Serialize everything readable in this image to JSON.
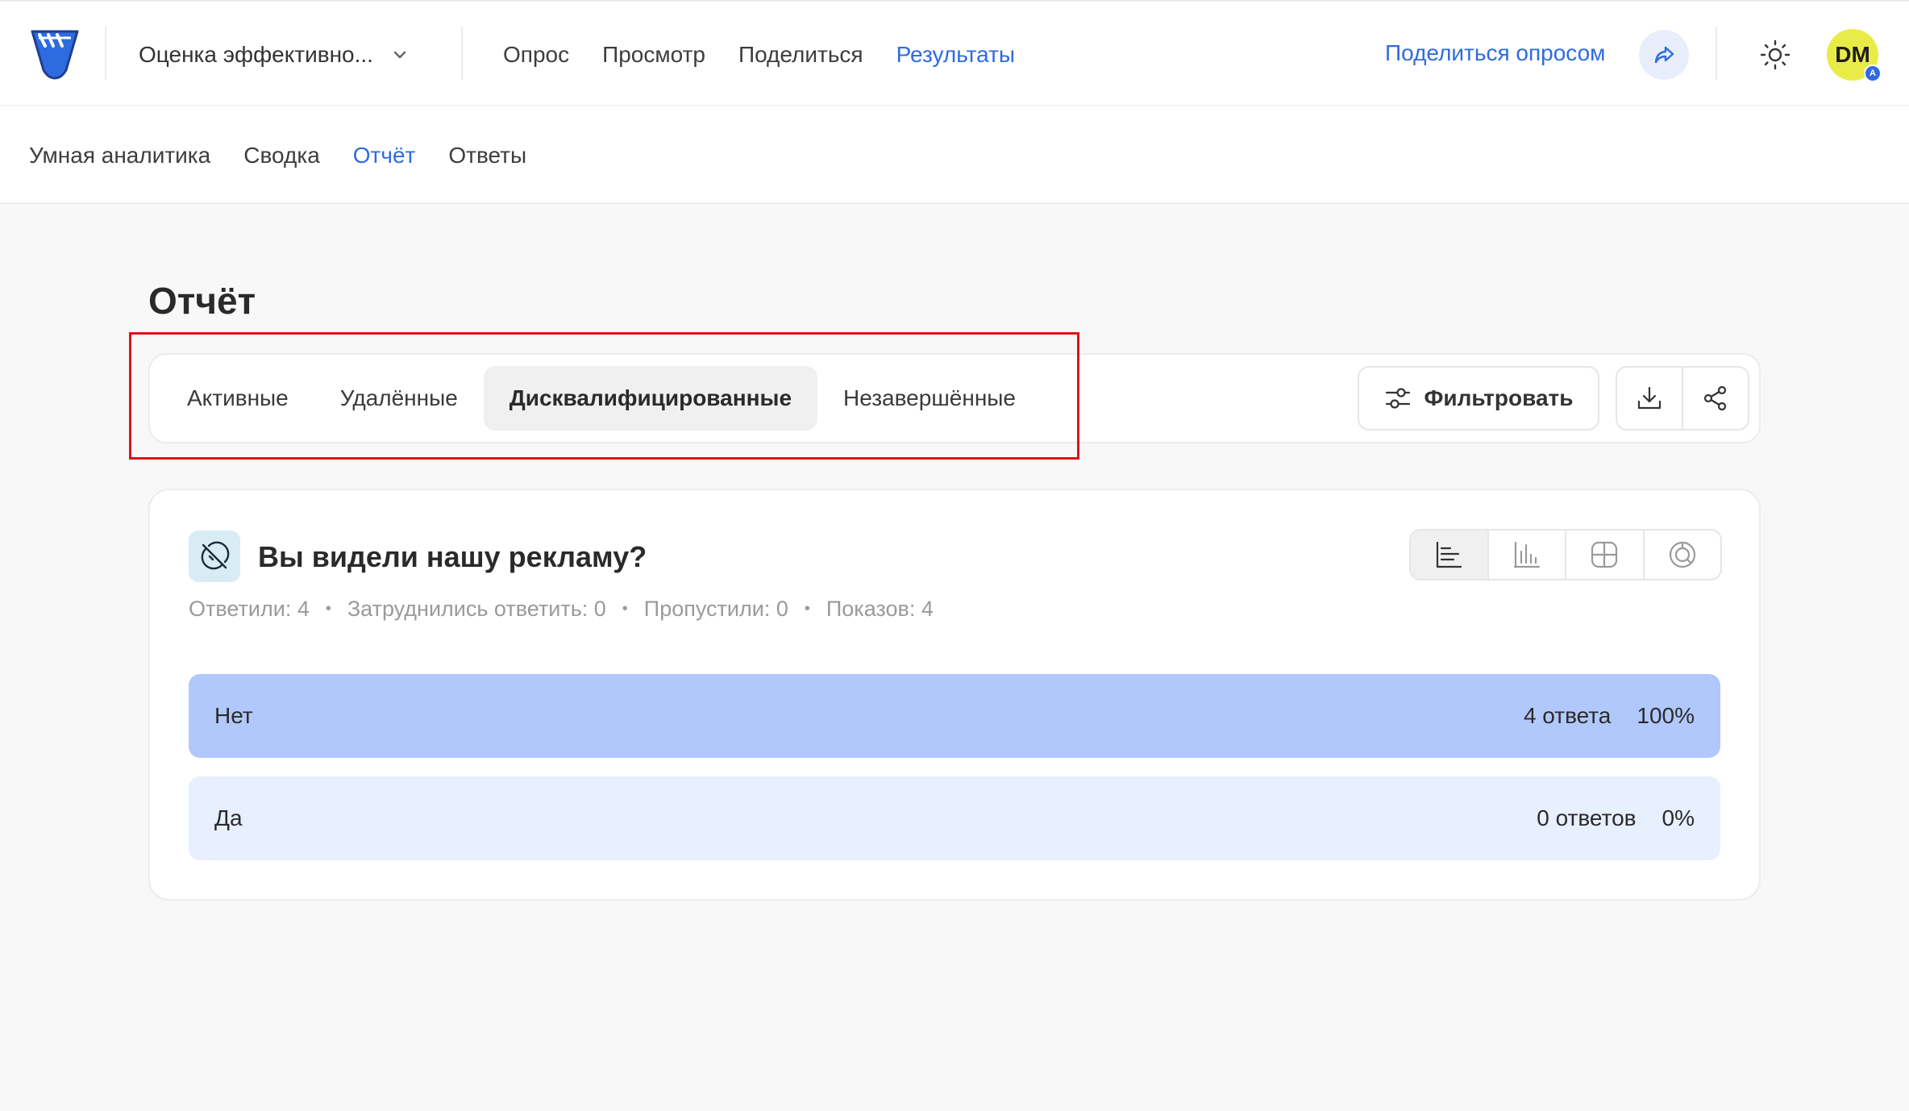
{
  "header": {
    "survey_name": "Оценка эффективно...",
    "nav": [
      "Опрос",
      "Просмотр",
      "Поделиться",
      "Результаты"
    ],
    "active_nav": "Результаты",
    "share_survey_label": "Поделиться опросом",
    "avatar_initials": "DM",
    "avatar_badge": "A",
    "accent_color": "#2f6be0"
  },
  "subnav": {
    "items": [
      "Умная аналитика",
      "Сводка",
      "Отчёт",
      "Ответы"
    ],
    "active": "Отчёт"
  },
  "page": {
    "title": "Отчёт"
  },
  "filters": {
    "tabs": [
      "Активные",
      "Удалённые",
      "Дисквалифицированные",
      "Незавершённые"
    ],
    "selected_tab": "Дисквалифицированные",
    "filter_button": "Фильтровать",
    "icons": [
      "download-icon",
      "share-nodes-icon"
    ]
  },
  "question": {
    "title": "Вы видели нашу рекламу?",
    "stats": [
      "Ответили: 4",
      "Затруднились ответить: 0",
      "Пропустили: 0",
      "Показов: 4"
    ],
    "view_modes": [
      "horizontal-bar-chart-icon",
      "vertical-bar-chart-icon",
      "grid-table-icon",
      "donut-chart-icon"
    ],
    "selected_view": "horizontal-bar-chart-icon",
    "answers": [
      {
        "label": "Нет",
        "count": "4 ответа",
        "percent": "100%",
        "share": 1.0
      },
      {
        "label": "Да",
        "count": "0 ответов",
        "percent": "0%",
        "share": 0.0
      }
    ],
    "bar_color": "#b1c8fd",
    "bar_track_color": "#e8efff"
  }
}
